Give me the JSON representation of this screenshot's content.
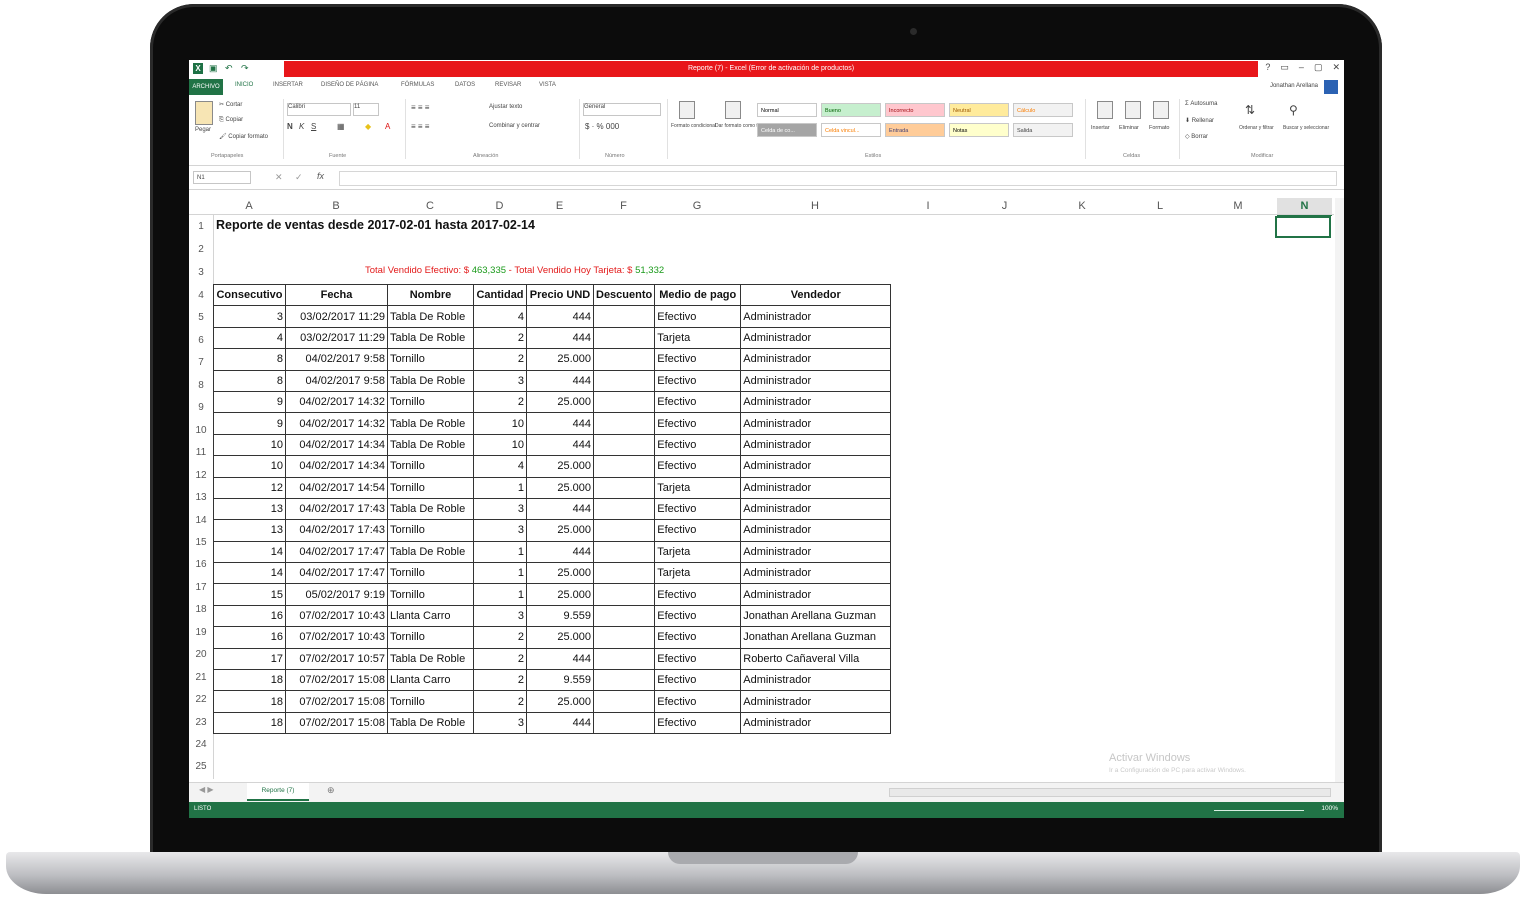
{
  "window": {
    "title": "Reporte (7) - Excel (Error de activación de productos)",
    "controls": [
      "?",
      "▭",
      "–",
      "▢",
      "✕"
    ]
  },
  "ribbon": {
    "file_tab": "ARCHIVO",
    "tabs": [
      "INICIO",
      "INSERTAR",
      "DISEÑO DE PÁGINA",
      "FÓRMULAS",
      "DATOS",
      "REVISAR",
      "VISTA"
    ],
    "user": "Jonathan Arellana",
    "clipboard": {
      "paste": "Pegar",
      "cut": "Cortar",
      "copy": "Copiar",
      "format_painter": "Copiar formato",
      "label": "Portapapeles"
    },
    "font": {
      "name": "Calibri",
      "size": "11",
      "label": "Fuente"
    },
    "alignment": {
      "wrap": "Ajustar texto",
      "merge": "Combinar y centrar",
      "label": "Alineación"
    },
    "number": {
      "format": "General",
      "label": "Número"
    },
    "styles": {
      "cond_format": "Formato condicional",
      "table_format": "Dar formato como tabla",
      "cells": [
        "Normal",
        "Bueno",
        "Incorrecto",
        "Neutral",
        "Cálculo",
        "Celda de co...",
        "Celda vincul...",
        "Entrada",
        "Notas",
        "Salida"
      ],
      "label": "Estilos"
    },
    "cells_group": {
      "insert": "Insertar",
      "delete": "Eliminar",
      "format": "Formato",
      "label": "Celdas"
    },
    "editing": {
      "autosum": "Autosuma",
      "fill": "Rellenar",
      "clear": "Borrar",
      "sort": "Ordenar y filtrar",
      "find": "Buscar y seleccionar",
      "label": "Modificar"
    }
  },
  "formula_bar": {
    "name_box": "N1",
    "fx": "fx",
    "value": ""
  },
  "columns": [
    "A",
    "B",
    "C",
    "D",
    "E",
    "F",
    "G",
    "H",
    "I",
    "J",
    "K",
    "L",
    "M",
    "N"
  ],
  "rows": [
    "1",
    "2",
    "3",
    "4",
    "5",
    "6",
    "7",
    "8",
    "9",
    "10",
    "11",
    "12",
    "13",
    "14",
    "15",
    "16",
    "17",
    "18",
    "19",
    "20",
    "21",
    "22",
    "23",
    "24",
    "25"
  ],
  "report": {
    "title": "Reporte de ventas desde 2017-02-01 hasta 2017-02-14",
    "totals_cash_label": "Total Vendido Efectivo: $",
    "totals_cash_value": "463,335",
    "totals_sep": " - ",
    "totals_card_label": "Total Vendido Hoy Tarjeta: $",
    "totals_card_value": "51,332",
    "headers": [
      "Consecutivo",
      "Fecha",
      "Nombre",
      "Cantidad",
      "Precio UND",
      "Descuento",
      "Medio de pago",
      "Vendedor"
    ],
    "rows": [
      [
        "3",
        "03/02/2017 11:29",
        "Tabla De Roble",
        "4",
        "444",
        "",
        "Efectivo",
        "Administrador"
      ],
      [
        "4",
        "03/02/2017 11:29",
        "Tabla De Roble",
        "2",
        "444",
        "",
        "Tarjeta",
        "Administrador"
      ],
      [
        "8",
        "04/02/2017 9:58",
        "Tornillo",
        "2",
        "25.000",
        "",
        "Efectivo",
        "Administrador"
      ],
      [
        "8",
        "04/02/2017 9:58",
        "Tabla De Roble",
        "3",
        "444",
        "",
        "Efectivo",
        "Administrador"
      ],
      [
        "9",
        "04/02/2017 14:32",
        "Tornillo",
        "2",
        "25.000",
        "",
        "Efectivo",
        "Administrador"
      ],
      [
        "9",
        "04/02/2017 14:32",
        "Tabla De Roble",
        "10",
        "444",
        "",
        "Efectivo",
        "Administrador"
      ],
      [
        "10",
        "04/02/2017 14:34",
        "Tabla De Roble",
        "10",
        "444",
        "",
        "Efectivo",
        "Administrador"
      ],
      [
        "10",
        "04/02/2017 14:34",
        "Tornillo",
        "4",
        "25.000",
        "",
        "Efectivo",
        "Administrador"
      ],
      [
        "12",
        "04/02/2017 14:54",
        "Tornillo",
        "1",
        "25.000",
        "",
        "Tarjeta",
        "Administrador"
      ],
      [
        "13",
        "04/02/2017 17:43",
        "Tabla De Roble",
        "3",
        "444",
        "",
        "Efectivo",
        "Administrador"
      ],
      [
        "13",
        "04/02/2017 17:43",
        "Tornillo",
        "3",
        "25.000",
        "",
        "Efectivo",
        "Administrador"
      ],
      [
        "14",
        "04/02/2017 17:47",
        "Tabla De Roble",
        "1",
        "444",
        "",
        "Tarjeta",
        "Administrador"
      ],
      [
        "14",
        "04/02/2017 17:47",
        "Tornillo",
        "1",
        "25.000",
        "",
        "Tarjeta",
        "Administrador"
      ],
      [
        "15",
        "05/02/2017 9:19",
        "Tornillo",
        "1",
        "25.000",
        "",
        "Efectivo",
        "Administrador"
      ],
      [
        "16",
        "07/02/2017 10:43",
        "Llanta Carro",
        "3",
        "9.559",
        "",
        "Efectivo",
        "Jonathan Arellana Guzman"
      ],
      [
        "16",
        "07/02/2017 10:43",
        "Tornillo",
        "2",
        "25.000",
        "",
        "Efectivo",
        "Jonathan Arellana Guzman"
      ],
      [
        "17",
        "07/02/2017 10:57",
        "Tabla De Roble",
        "2",
        "444",
        "",
        "Efectivo",
        "Roberto Cañaveral Villa"
      ],
      [
        "18",
        "07/02/2017 15:08",
        "Llanta Carro",
        "2",
        "9.559",
        "",
        "Efectivo",
        "Administrador"
      ],
      [
        "18",
        "07/02/2017 15:08",
        "Tornillo",
        "2",
        "25.000",
        "",
        "Efectivo",
        "Administrador"
      ],
      [
        "18",
        "07/02/2017 15:08",
        "Tabla De Roble",
        "3",
        "444",
        "",
        "Efectivo",
        "Administrador"
      ]
    ]
  },
  "watermark": {
    "line1": "Activar Windows",
    "line2": "Ir a Configuración de PC para activar Windows."
  },
  "sheets": {
    "active": "Reporte (7)",
    "add": "⊕",
    "nav": "◀ ▶"
  },
  "status": {
    "left": "LISTO",
    "zoom": "100%"
  },
  "colors": {
    "excel_green": "#217346",
    "title_red": "#e8161a",
    "total_label": "#e31b1b",
    "total_value": "#1a9a1a"
  }
}
